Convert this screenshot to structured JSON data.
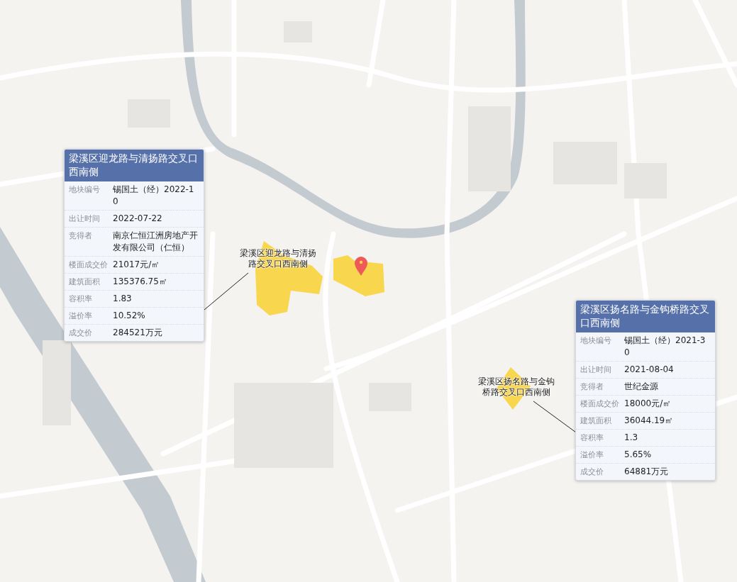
{
  "parcels": [
    {
      "map_label": "梁溪区迎龙路与清扬路交叉口西南侧",
      "title": "梁溪区迎龙路与清扬路交叉口西南侧",
      "fields": [
        {
          "label": "地块编号",
          "value": "锡国土（经）2022-10"
        },
        {
          "label": "出让时间",
          "value": "2022-07-22"
        },
        {
          "label": "竞得者",
          "value": "南京仁恒江洲房地产开发有限公司（仁恒）"
        },
        {
          "label": "楼面成交价",
          "value": "21017元/㎡"
        },
        {
          "label": "建筑面积",
          "value": "135376.75㎡"
        },
        {
          "label": "容积率",
          "value": "1.83"
        },
        {
          "label": "溢价率",
          "value": "10.52%"
        },
        {
          "label": "成交价",
          "value": "284521万元"
        }
      ]
    },
    {
      "map_label": "梁溪区扬名路与金钩桥路交叉口西南侧",
      "title": "梁溪区扬名路与金钩桥路交叉口西南侧",
      "fields": [
        {
          "label": "地块编号",
          "value": "锡国土（经）2021-30"
        },
        {
          "label": "出让时间",
          "value": "2021-08-04"
        },
        {
          "label": "竞得者",
          "value": "世纪金源"
        },
        {
          "label": "楼面成交价",
          "value": "18000元/㎡"
        },
        {
          "label": "建筑面积",
          "value": "36044.19㎡"
        },
        {
          "label": "容积率",
          "value": "1.3"
        },
        {
          "label": "溢价率",
          "value": "5.65%"
        },
        {
          "label": "成交价",
          "value": "64881万元"
        }
      ]
    }
  ]
}
